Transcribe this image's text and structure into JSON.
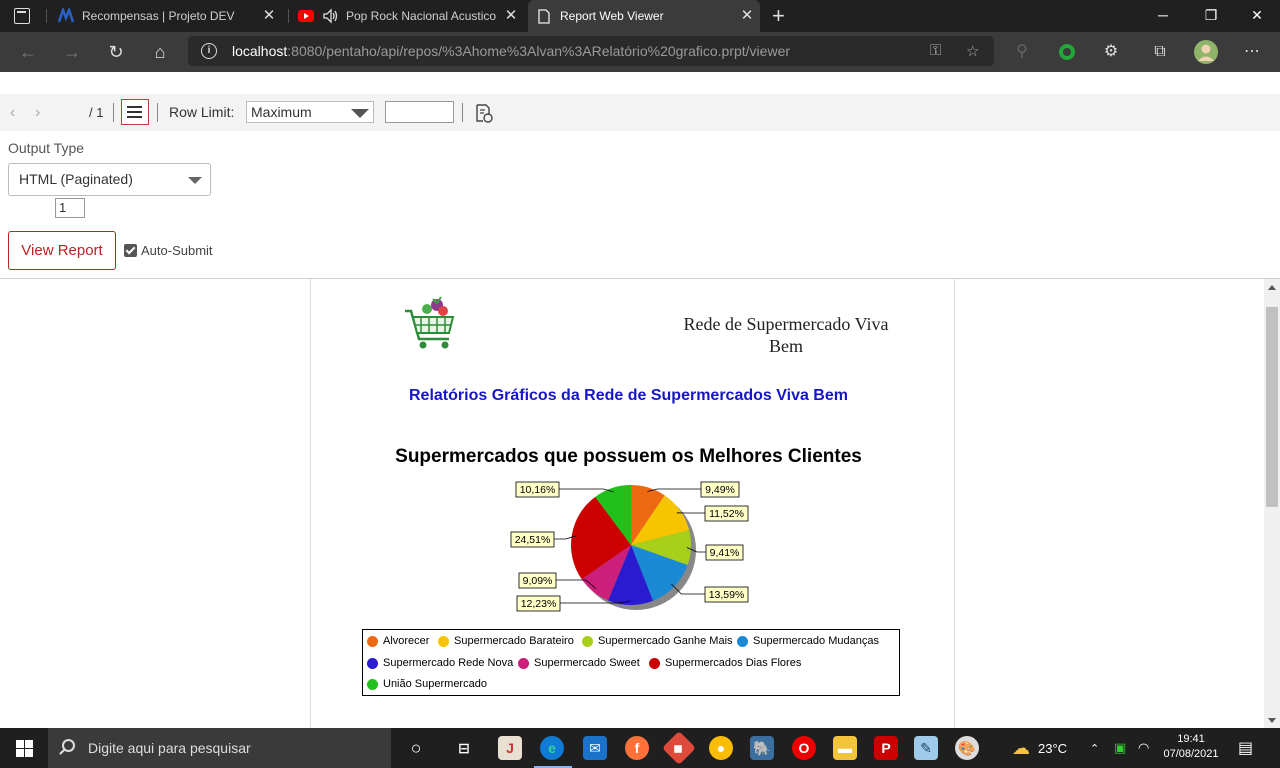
{
  "browser": {
    "tabs": [
      {
        "title": "Recompensas | Projeto DEV",
        "active": false
      },
      {
        "title": "Pop Rock Nacional Acustico",
        "active": false
      },
      {
        "title": "Report Web Viewer",
        "active": true
      }
    ],
    "url_host": "localhost",
    "url_rest": ":8080/pentaho/api/repos/%3Ahome%3Alvan%3ARelatório%20grafico.prpt/viewer"
  },
  "toolbar": {
    "page_current": "1",
    "page_total": "/ 1",
    "row_limit_label": "Row Limit:",
    "row_limit_value": "Maximum"
  },
  "params": {
    "output_type_label": "Output Type",
    "output_type_value": "HTML (Paginated)",
    "view_report_label": "View Report",
    "auto_submit_label": "Auto-Submit"
  },
  "report": {
    "company_line1": "Rede de Supermercado Viva",
    "company_line2": "Bem",
    "title": "Relatórios Gráficos da Rede de Supermercados Viva Bem"
  },
  "chart_data": {
    "type": "pie",
    "title": "Supermercados que possuem os Melhores Clientes",
    "legend_position": "bottom",
    "slices": [
      {
        "name": "Alvorecer",
        "value": 9.49,
        "label": "9,49%",
        "color": "#ee6a12"
      },
      {
        "name": "Supermercado Barateiro",
        "value": 11.52,
        "label": "11,52%",
        "color": "#f7c500"
      },
      {
        "name": "Supermercado Ganhe Mais",
        "value": 9.41,
        "label": "9,41%",
        "color": "#a8d01a"
      },
      {
        "name": "Supermercado Mudanças",
        "value": 13.59,
        "label": "13,59%",
        "color": "#1a8ad4"
      },
      {
        "name": "Supermercado Rede Nova",
        "value": 12.23,
        "label": "12,23%",
        "color": "#2a1ad0"
      },
      {
        "name": "Supermercado Sweet",
        "value": 9.09,
        "label": "9,09%",
        "color": "#cc1f7c"
      },
      {
        "name": "Supermercados Dias Flores",
        "value": 24.51,
        "label": "24,51%",
        "color": "#cc0000"
      },
      {
        "name": "União Supermercado",
        "value": 10.16,
        "label": "10,16%",
        "color": "#22c01a"
      }
    ]
  },
  "taskbar": {
    "search_placeholder": "Digite aqui para pesquisar",
    "weather": "23°C",
    "time": "19:41",
    "date": "07/08/2021"
  }
}
